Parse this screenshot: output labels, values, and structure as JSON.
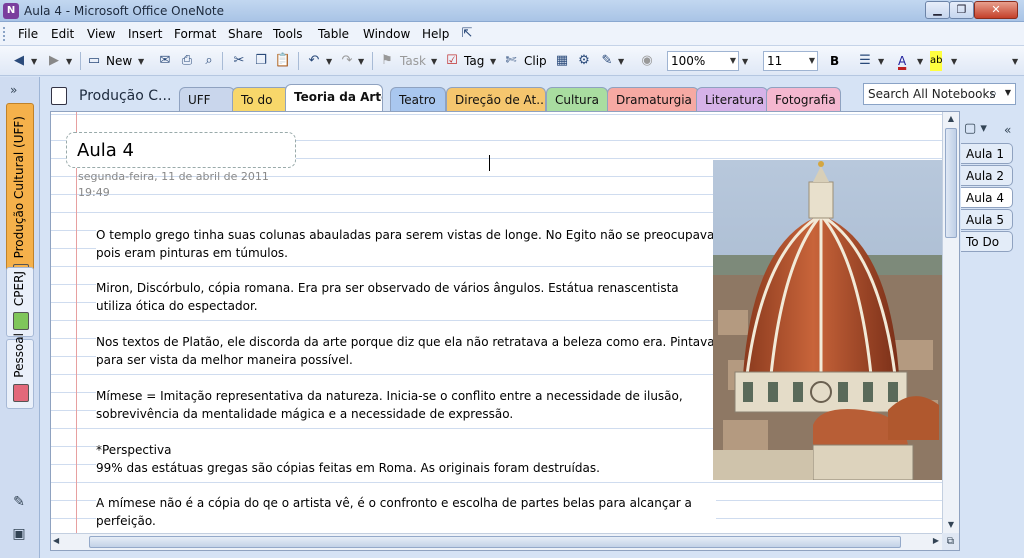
{
  "window": {
    "title": "Aula 4 - Microsoft Office OneNote",
    "app_icon": "N"
  },
  "menu": [
    "File",
    "Edit",
    "View",
    "Insert",
    "Format",
    "Share",
    "Tools",
    "Table",
    "Window",
    "Help"
  ],
  "toolbar": {
    "new_label": "New",
    "task_label": "Task",
    "tag_label": "Tag",
    "clip_label": "Clip",
    "zoom": "100%",
    "font_size": "11",
    "bold_label": "B",
    "font_color_label": "A",
    "highlight_label": "ab"
  },
  "notebooks": [
    {
      "label": "Produção Cultural (UFF)",
      "color": "#f5b14b",
      "active": true
    },
    {
      "label": "CPERJ",
      "color": "#7fc65a",
      "active": false
    },
    {
      "label": "Pessoal",
      "color": "#e2687a",
      "active": false
    }
  ],
  "notebook_title": "Produção C...",
  "sections": [
    {
      "label": "UFF",
      "color": "#c9d6ec"
    },
    {
      "label": "To do",
      "color": "#f8d76a"
    },
    {
      "label": "Teoria da Arte",
      "color": "#ffffff"
    },
    {
      "label": "Teatro",
      "color": "#a9c7ef"
    },
    {
      "label": "Direção de At...",
      "color": "#f5c66e"
    },
    {
      "label": "Cultura",
      "color": "#a9dda0"
    },
    {
      "label": "Dramaturgia",
      "color": "#f6a9a3"
    },
    {
      "label": "Literatura",
      "color": "#d6b2e8"
    },
    {
      "label": "Fotografia",
      "color": "#f4b7cf"
    }
  ],
  "search": {
    "placeholder": "Search All Notebooks"
  },
  "page": {
    "title": "Aula 4",
    "date": "segunda-feira, 11 de abril de 2011",
    "time": "19:49",
    "paragraphs": [
      "O templo grego tinha suas colunas abauladas para serem vistas de longe. No Egito não se preocupava pois eram pinturas em túmulos.",
      "Miron, Discórbulo, cópia romana. Era pra  ser observado de vários ângulos. Estátua renascentista utiliza ótica do espectador.",
      "Nos textos de Platão, ele discorda da arte porque diz que ela não retratava a  beleza como era. Pintava para ser vista da melhor maneira possível.",
      "Mímese = Imitação representativa da natureza. Inicia-se o conflito entre a necessidade de ilusão, sobrevivência da mentalidade mágica e a necessidade de expressão.",
      "*Perspectiva\n99% das estátuas gregas são cópias feitas em Roma. As originais foram destruídas.",
      "A mímese não é a cópia do qe o artista vê, é o confronto e escolha de partes belas para alcançar a perfeição."
    ]
  },
  "page_tabs": [
    {
      "label": "Aula 1",
      "active": false
    },
    {
      "label": "Aula 2",
      "active": false
    },
    {
      "label": "Aula 4",
      "active": true
    },
    {
      "label": "Aula 5",
      "active": false
    },
    {
      "label": "To Do",
      "active": false
    }
  ]
}
